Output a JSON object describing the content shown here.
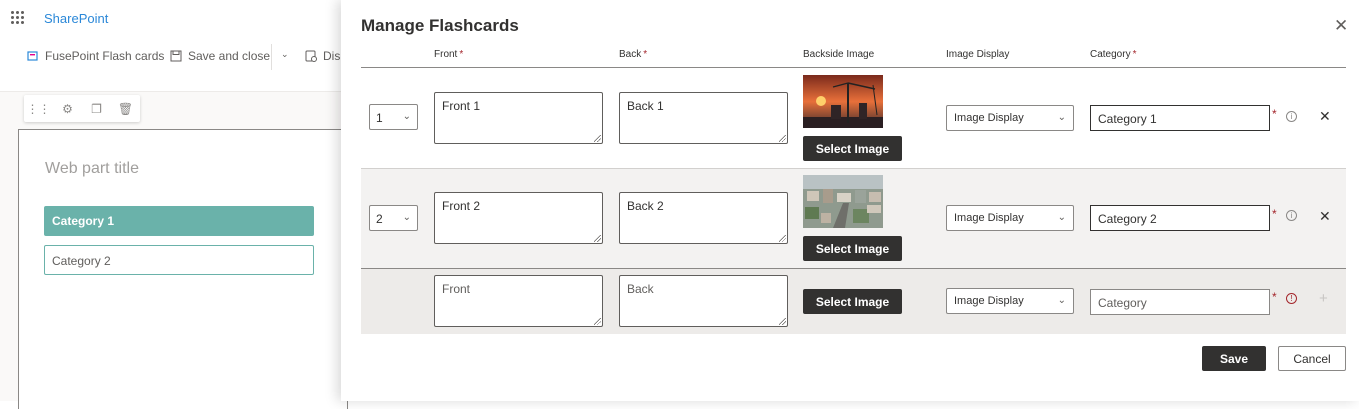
{
  "background": {
    "brand": "SharePoint",
    "commands": [
      {
        "label": "FusePoint Flash cards",
        "icon": "flashcards-icon"
      },
      {
        "label": "Save and close",
        "icon": "save-icon"
      },
      {
        "label": "Dis",
        "icon": "discard-icon"
      }
    ],
    "toolbar_icons": [
      "drag-handle-icon",
      "edit-properties-icon",
      "duplicate-icon",
      "delete-icon"
    ],
    "webpart_title_placeholder": "Web part title",
    "categories": [
      "Category 1",
      "Category 2"
    ],
    "accent_color": "#6ab2aa"
  },
  "panel": {
    "title": "Manage Flashcards",
    "close_icon": "close-icon",
    "columns": {
      "front": "Front",
      "back": "Back",
      "backside_image": "Backside Image",
      "image_display": "Image Display",
      "category": "Category",
      "required_mark": "*"
    },
    "rows": [
      {
        "order": "1",
        "front": "Front 1",
        "back": "Back 1",
        "image": "construction-sunset-image",
        "select_image": "Select Image",
        "image_display": "Image Display",
        "category": "Category 1",
        "required_mark": "*"
      },
      {
        "order": "2",
        "front": "Front 2",
        "back": "Back 2",
        "image": "city-aerial-image",
        "select_image": "Select Image",
        "image_display": "Image Display",
        "category": "Category 2",
        "required_mark": "*"
      }
    ],
    "new_row": {
      "front_placeholder": "Front",
      "back_placeholder": "Back",
      "select_image": "Select Image",
      "image_display": "Image Display",
      "category_placeholder": "Category",
      "required_mark": "*"
    },
    "footer": {
      "save": "Save",
      "cancel": "Cancel"
    }
  }
}
